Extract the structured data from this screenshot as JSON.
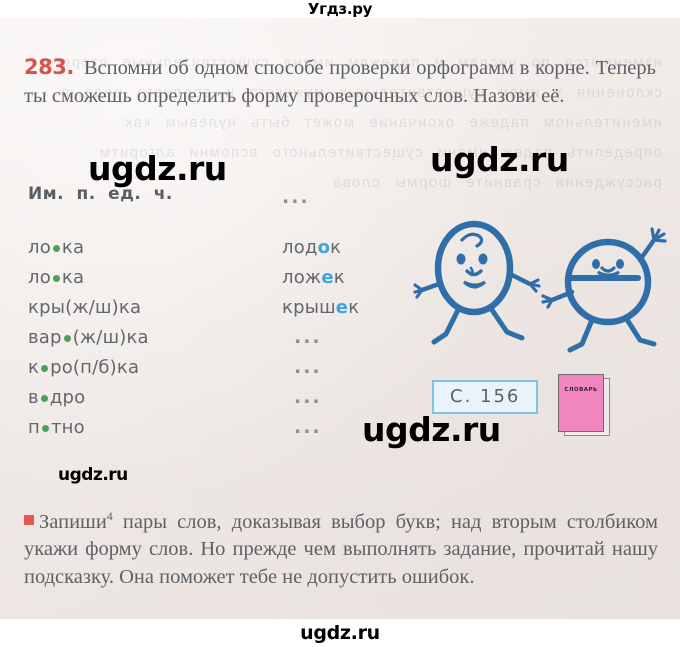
{
  "watermarks": {
    "top": "Угдз.ру",
    "bottom": "ugdz.ru",
    "page_a": "ugdz.ru",
    "page_b": "ugdz.ru",
    "page_c": "ugdz.ru",
    "page_d": "ugdz.ru"
  },
  "exercise": {
    "number": "283.",
    "intro": "Вспомни об одном способе проверки орфограмм в корне. Теперь ты сможешь определить форму проверочных слов. Назови её."
  },
  "table": {
    "case_label": "Им. п. ед. ч.",
    "case_value": "...",
    "rows": [
      {
        "left_pre": "ло",
        "left_dot": true,
        "left_post": "ка",
        "right_pre": "лод",
        "right_hl": "о",
        "right_post": "к"
      },
      {
        "left_pre": "ло",
        "left_dot": true,
        "left_post": "ка",
        "right_pre": "лож",
        "right_hl": "е",
        "right_post": "к"
      },
      {
        "left_pre": "кры(ж/ш)ка",
        "left_dot": false,
        "left_post": "",
        "right_pre": "крыш",
        "right_hl": "е",
        "right_post": "к"
      },
      {
        "left_pre": "вар",
        "left_dot": true,
        "left_post": "(ж/ш)ка",
        "right_pre": "",
        "right_hl": "",
        "right_post": "...",
        "ellipsis": true
      },
      {
        "left_pre": "к",
        "left_dot": true,
        "left_post": "ро(п/б)ка",
        "right_pre": "",
        "right_hl": "",
        "right_post": "...",
        "ellipsis": true
      },
      {
        "left_pre": "в",
        "left_dot": true,
        "left_post": "дро",
        "right_pre": "",
        "right_hl": "",
        "right_post": "...",
        "ellipsis": true
      },
      {
        "left_pre": "п",
        "left_dot": true,
        "left_post": "тно",
        "right_pre": "",
        "right_hl": "",
        "right_post": "...",
        "ellipsis": true
      }
    ]
  },
  "page_reference": {
    "label": "С. 156"
  },
  "dictionary_book": {
    "title": "СЛОВАРЬ"
  },
  "task": {
    "label": "Запиши",
    "superscript": "4",
    "text": " пары слов, доказывая выбор букв; над вторым столбиком укажи форму слов. Но прежде чем выполнять задание, прочитай нашу подсказку. Она поможет тебе не допустить ошибок."
  },
  "showthrough_text": "изменяются по числам и падежам имена существительные второго склонения у имён существительных мужского и среднего рода в именительном падеже окончание может быть нулевым как определить падеж имени существительного вспомни алгоритм рассуждения сравните формы слова",
  "colors": {
    "exercise_number": "#d6544b",
    "bullet": "#e05a4e",
    "dot_marker": "#4f9e5a",
    "highlight_letter": "#3ca5dd",
    "pageref_border": "#7fc2e8",
    "pageref_fill": "#e8f3fb",
    "book_cover": "#ef86c0",
    "figure_ink": "#2f6ea8",
    "paper": "#f2eeec",
    "text": "#5d6166"
  }
}
